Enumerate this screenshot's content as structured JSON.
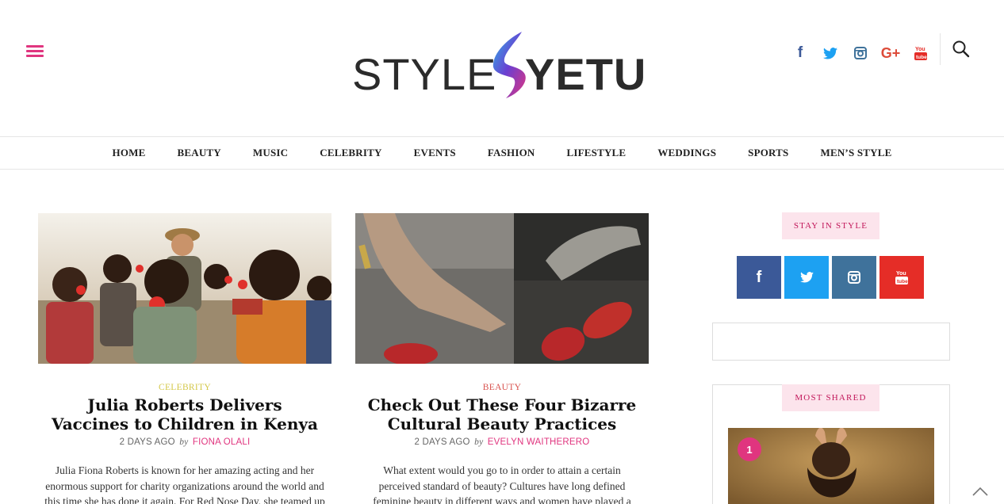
{
  "header": {
    "logo_left": "STYLE",
    "logo_right": "YETU",
    "social_icons": [
      "facebook-icon",
      "twitter-icon",
      "instagram-icon",
      "google-plus-icon",
      "youtube-icon"
    ],
    "social_glyphs": {
      "facebook": "f",
      "twitter": "t",
      "instagram": "◎",
      "googleplus": "G+",
      "youtube": "You"
    }
  },
  "nav": {
    "items": [
      "HOME",
      "BEAUTY",
      "MUSIC",
      "CELEBRITY",
      "EVENTS",
      "FASHION",
      "LIFESTYLE",
      "WEDDINGS",
      "SPORTS",
      "MEN’S STYLE"
    ]
  },
  "articles": [
    {
      "category": "CELEBRITY",
      "category_color": "#d4c84a",
      "title": "Julia Roberts Delivers Vaccines to Children in Kenya",
      "time": "2 DAYS AGO",
      "by": "by",
      "author": "FIONA OLALI",
      "excerpt": "Julia Fiona Roberts is known for her amazing acting and her enormous support for charity organizations around the world and this time she has done it again. For Red Nose Day, she teamed up"
    },
    {
      "category": "BEAUTY",
      "category_color": "#d9534f",
      "title": "Check Out These Four Bizarre Cultural Beauty Practices",
      "time": "2 DAYS AGO",
      "by": "by",
      "author": "EVELYN WAITHERERO",
      "excerpt": "What extent would you go to in order to attain a certain perceived standard of beauty? Cultures have long defined feminine beauty in different ways and women have played a huge role in abiding by"
    }
  ],
  "sidebar": {
    "stay_in_style": "STAY IN STYLE",
    "social_buttons": [
      {
        "icon": "facebook-icon",
        "glyph": "f",
        "color": "#3b5998"
      },
      {
        "icon": "twitter-icon",
        "glyph": "t",
        "color": "#1da1f2"
      },
      {
        "icon": "instagram-icon",
        "glyph": "◎",
        "color": "#3f729b"
      },
      {
        "icon": "youtube-icon",
        "glyph": "You",
        "color": "#e52d27"
      }
    ],
    "most_shared": "MOST SHARED",
    "most_shared_rank": "1"
  },
  "colors": {
    "accent": "#e0357f",
    "pill_bg": "#fce4ec"
  }
}
